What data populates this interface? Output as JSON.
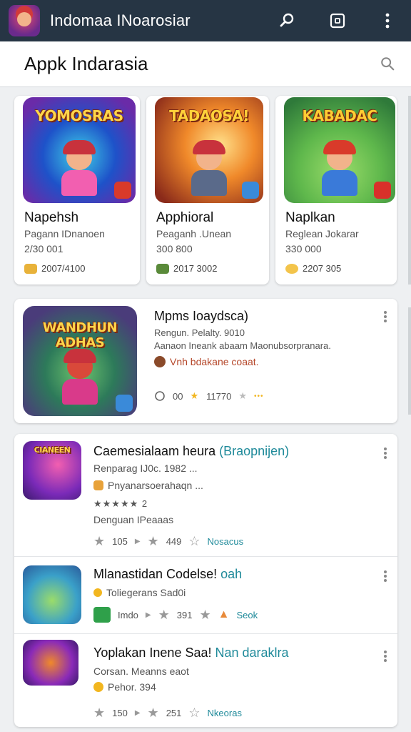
{
  "top_bar": {
    "title": "Indomaa INoarosiar",
    "icons": [
      "search-icon",
      "square-icon",
      "overflow-menu-icon"
    ]
  },
  "search_bar": {
    "label": "Appk Indarasia",
    "icon": "search-icon"
  },
  "featured": [
    {
      "art_title": "YOMOSRAS",
      "name": "Napehsh",
      "subtitle": "Pagann IDnanoen",
      "number": "2/30 001",
      "meta": "2007/4100",
      "color_a": "#1e52c9",
      "color_b": "#f25fb0"
    },
    {
      "art_title": "TADAOSA!",
      "name": "Apphioral",
      "subtitle": "Peaganh .Unean",
      "number": "300 800",
      "meta": "2017 3002",
      "color_a": "#f0892a",
      "color_b": "#c8323c"
    },
    {
      "art_title": "KABADAC",
      "name": "Naplkan",
      "subtitle": "Reglean Jokarar",
      "number": "330 000",
      "meta": "2207 305",
      "color_a": "#5fb84c",
      "color_b": "#f3c44b"
    }
  ],
  "wide_card": {
    "art_title": "WANDHUN ADHAS",
    "title": "Mpms Ioaydsca)",
    "line1": "Rengun. Pelalty. 9010",
    "line2": "Aanaon Ineank abaam Maonubsorpranara.",
    "highlight": "Vnh bdakane coaat.",
    "stat_comments": "00",
    "stat_rating": "11770"
  },
  "list_items": [
    {
      "title": "Caemesialaam heura",
      "title_accent": "(Braopnijen)",
      "line2": "Renparag IJ0c. 1982 ...",
      "tag": "Pnyanarsoerahaqn ...",
      "rating_text": "★★★★★ 2",
      "line4": "Denguan IPeaaas",
      "stat1": "105",
      "stat2": "449",
      "stat3": "Nosacus"
    },
    {
      "title": "Mlanastidan Codelse!",
      "title_accent": "oah",
      "line2": "Toliegerans Sad0i",
      "stat1": "Imdo",
      "stat2": "391",
      "stat3": "Seok"
    },
    {
      "title": "Yoplakan Inene Saa!",
      "title_accent": "Nan daraklra",
      "line2": "Corsan. Meanns eaot",
      "tag": "Pehor. 394",
      "stat1": "150",
      "stat2": "251",
      "stat3": "Nkeoras"
    }
  ]
}
